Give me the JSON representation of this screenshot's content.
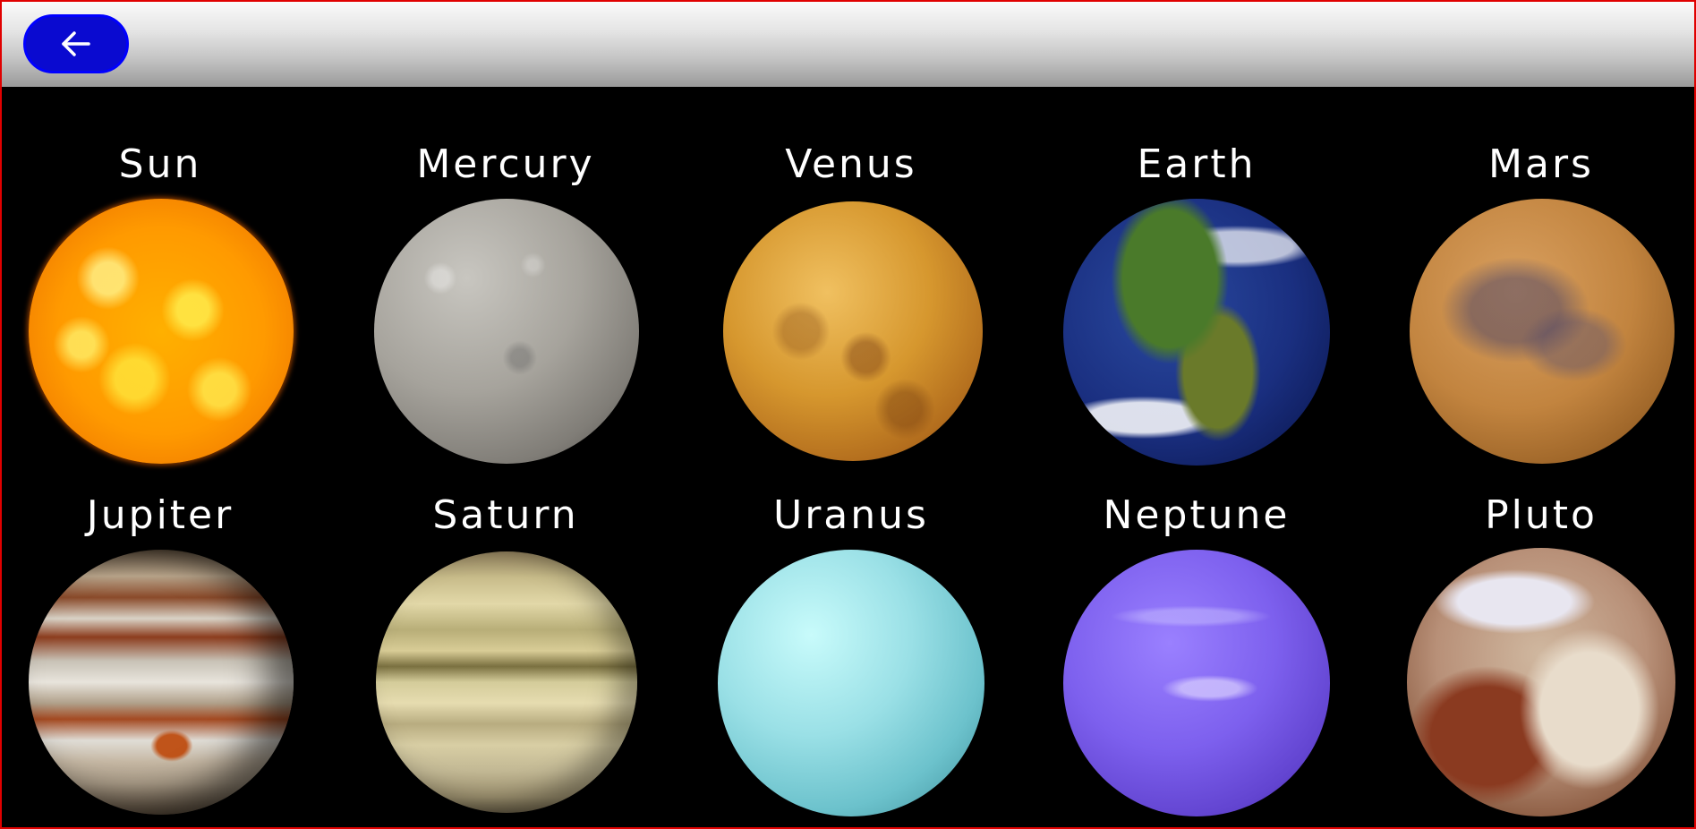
{
  "header": {
    "back_button_icon": "arrow-left-icon"
  },
  "planets": [
    {
      "name": "Sun"
    },
    {
      "name": "Mercury"
    },
    {
      "name": "Venus"
    },
    {
      "name": "Earth"
    },
    {
      "name": "Mars"
    },
    {
      "name": "Jupiter"
    },
    {
      "name": "Saturn"
    },
    {
      "name": "Uranus"
    },
    {
      "name": "Neptune"
    },
    {
      "name": "Pluto"
    }
  ],
  "colors": {
    "background": "#000000",
    "back_button": "#0a0ad0",
    "frame_border": "#e00000",
    "label_text": "#ffffff"
  }
}
